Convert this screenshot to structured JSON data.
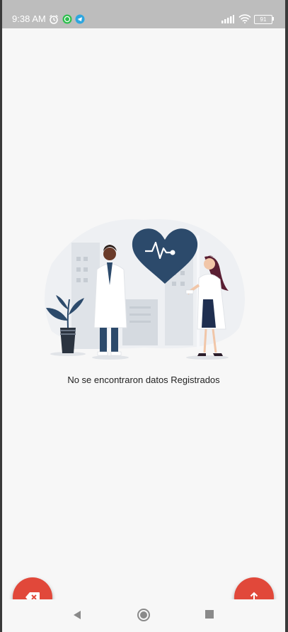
{
  "status_bar": {
    "time": "9:38 AM",
    "battery": "91",
    "icons": [
      "alarm-icon",
      "whatsapp-icon",
      "telegram-icon",
      "signal-icon",
      "wifi-icon",
      "battery-icon"
    ]
  },
  "main": {
    "empty_message": "No se encontraron datos Registrados",
    "illustration": "doctors-heart-illustration"
  },
  "actions": {
    "left_fab_icon": "backspace-icon",
    "right_fab_icon": "upload-icon"
  },
  "nav_bar": {
    "icons": [
      "back-triangle-icon",
      "home-circle-icon",
      "recents-square-icon"
    ]
  },
  "colors": {
    "accent": "#e1483a",
    "heart": "#2c4a6b",
    "status_bar": "#bdbdbd",
    "background": "#f7f7f7"
  }
}
